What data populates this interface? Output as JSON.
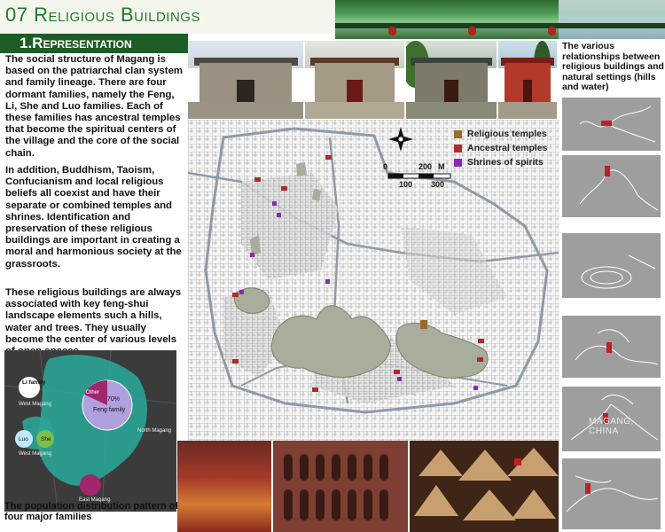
{
  "header": {
    "title": "07 Religious Buildings",
    "section": "1.Representation"
  },
  "text": {
    "p1": "The social structure of Magang is based on the patriarchal clan system and family lineage. There are four dormant families, namely the Feng, Li, She and Luo families. Each of these families has ancestral temples that become the spiritual centers of the village and the core of the social chain.",
    "p2": "In addition, Buddhism, Taoism, Confucianism and local religious beliefs all coexist and have their separate or combined temples and shrines. Identification and preservation of these religious buildings are important in creating a moral and harmonious society at the grassroots.",
    "p3": "These religious buildings are always associated with key feng-shui landscape elements such a hills, water and trees. They usually become the center of various levels of open spaces."
  },
  "legend": [
    {
      "label": "Religious temples",
      "color": "#9a6b2c"
    },
    {
      "label": "Ancestral temples",
      "color": "#b02a2a"
    },
    {
      "label": "Shrines of spirits",
      "color": "#8a2ab3"
    }
  ],
  "scale": {
    "upper": [
      "0",
      "200",
      "M"
    ],
    "lower": [
      "100",
      "300"
    ]
  },
  "right_caption": "The various relationships between religious buildings and natural settings (hills and water)",
  "watermark": "MAGANG, CHINA",
  "mini_map": {
    "labels": {
      "li": "Li family",
      "west": "West Magang",
      "other": "Other",
      "feng": "Feng family",
      "pct": "70%",
      "north": "North Magang",
      "luo": "Luo",
      "she": "She",
      "west2": "West Magang",
      "east": "East Magang"
    },
    "caption": "The population distribution pattern of four major families"
  },
  "colors": {
    "title_green": "#1f7a2a",
    "section_bar": "#1d5c26",
    "hills": "#a9ad9b",
    "road": "#8e9aa8",
    "teal_area": "#2aa596",
    "pie_magenta": "#a0266e"
  }
}
